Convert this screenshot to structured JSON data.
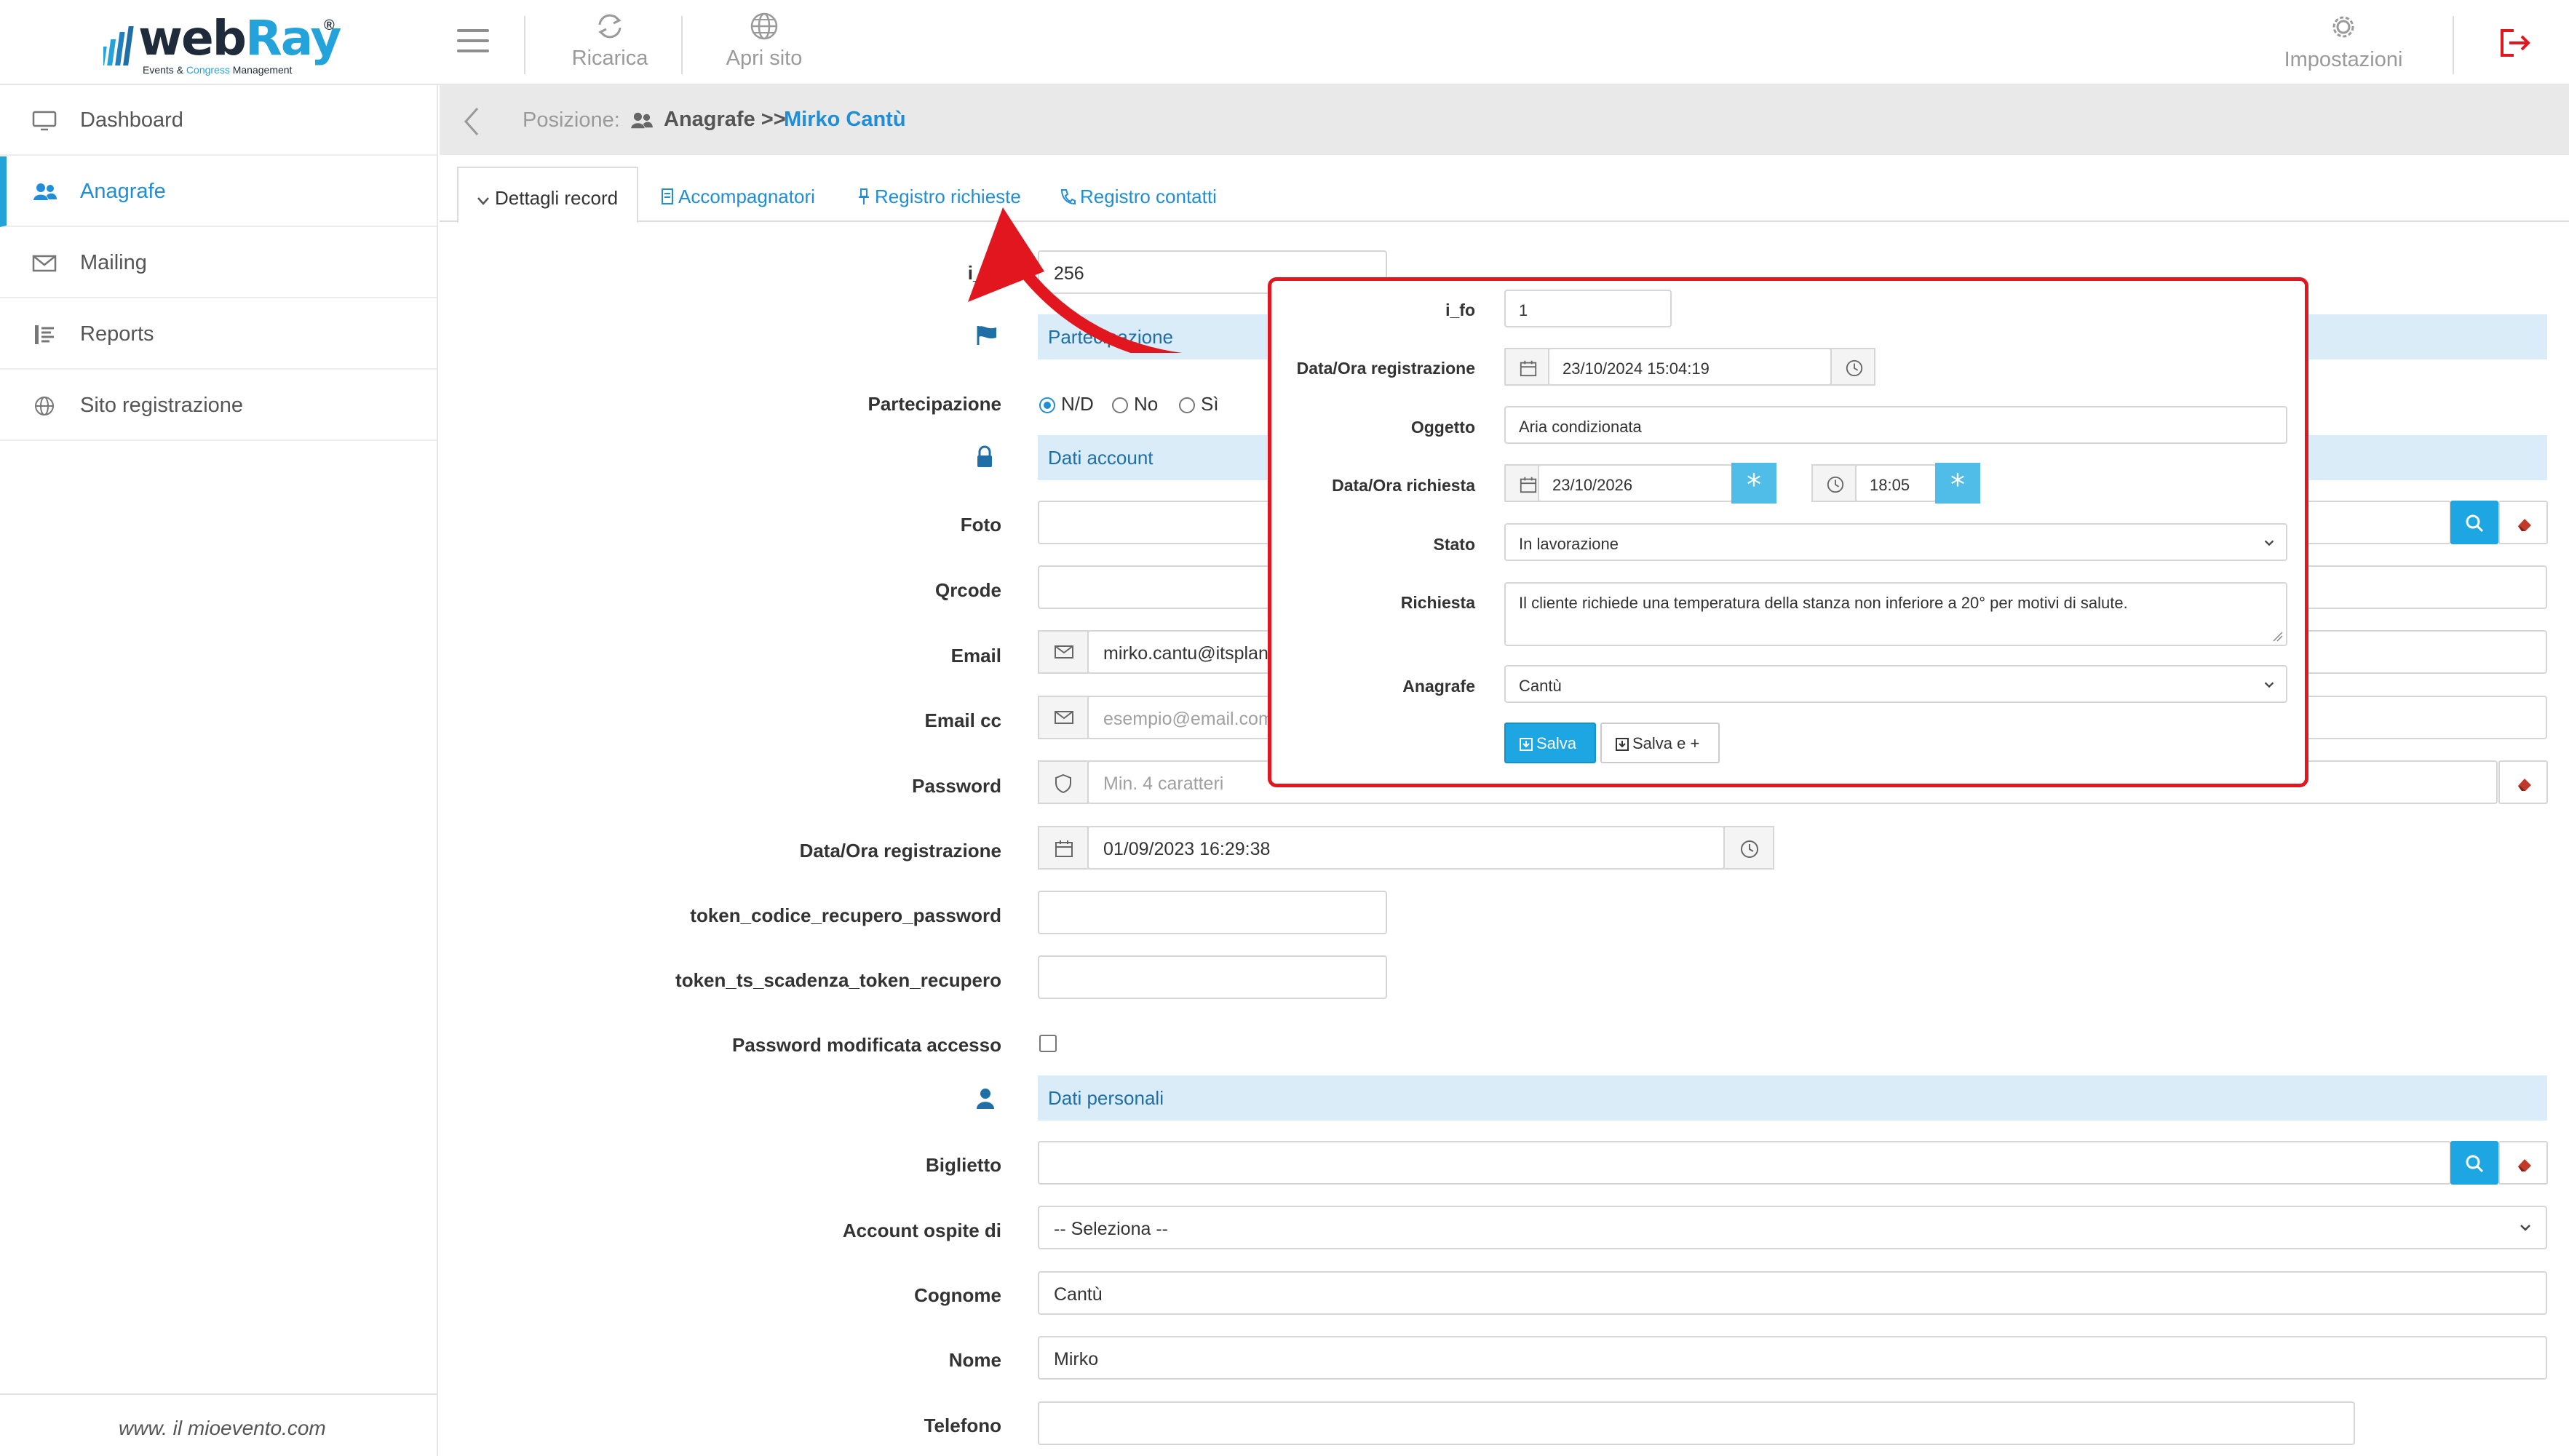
{
  "brand": {
    "name_a": "web",
    "name_b": "Ray",
    "reg": "®",
    "sub_a": "Events & ",
    "sub_b": "Congress",
    "sub_c": " Management"
  },
  "toolbar": {
    "reload_label": "Ricarica",
    "open_site_label": "Apri sito",
    "settings_label": "Impostazioni"
  },
  "sidebar": {
    "items": [
      {
        "label": "Dashboard"
      },
      {
        "label": "Anagrafe"
      },
      {
        "label": "Mailing"
      },
      {
        "label": "Reports"
      },
      {
        "label": "Sito registrazione"
      }
    ],
    "footer": "www. il mioevento.com",
    "active_index": 1
  },
  "breadcrumb": {
    "prefix": "Posizione:",
    "section": "Anagrafe",
    "sep": ">>",
    "current": "Mirko Cantù"
  },
  "tabs": [
    {
      "label": "Dettagli record",
      "active": true
    },
    {
      "label": "Accompagnatori"
    },
    {
      "label": "Registro richieste"
    },
    {
      "label": "Registro contatti"
    }
  ],
  "form": {
    "id_label": "i_fo",
    "id_value": "256",
    "section_participation": "Partecipazione",
    "participation_label": "Partecipazione",
    "participation_options": [
      "N/D",
      "No",
      "Sì"
    ],
    "participation_selected": "N/D",
    "section_account": "Dati account",
    "foto_label": "Foto",
    "qrcode_label": "Qrcode",
    "email_label": "Email",
    "email_value": "mirko.cantu@itsplanet.it",
    "emailcc_label": "Email cc",
    "emailcc_placeholder": "esempio@email.com",
    "password_label": "Password",
    "password_placeholder": "Min. 4 caratteri",
    "regdate_label": "Data/Ora registrazione",
    "regdate_value": "01/09/2023 16:29:38",
    "token_code_label": "token_codice_recupero_password",
    "token_ts_label": "token_ts_scadenza_token_recupero",
    "pwd_changed_label": "Password modificata accesso",
    "section_personal": "Dati personali",
    "ticket_label": "Biglietto",
    "guest_label": "Account ospite di",
    "guest_value": "-- Seleziona --",
    "surname_label": "Cognome",
    "surname_value": "Cantù",
    "name_label": "Nome",
    "name_value": "Mirko",
    "phone_label": "Telefono"
  },
  "popup": {
    "id_label": "i_fo",
    "id_value": "1",
    "regdate_label": "Data/Ora registrazione",
    "regdate_value": "23/10/2024 15:04:19",
    "subject_label": "Oggetto",
    "subject_value": "Aria condizionata",
    "reqdate_label": "Data/Ora richiesta",
    "reqdate_value": "23/10/2026",
    "reqtime_value": "18:05",
    "status_label": "Stato",
    "status_value": "In lavorazione",
    "request_label": "Richiesta",
    "request_value": "Il cliente richiede una temperatura della stanza non inferiore a 20° per motivi di salute.",
    "registry_label": "Anagrafe",
    "registry_value": "Cantù",
    "save_label": "Salva",
    "save_plus_label": "Salva e +"
  },
  "colors": {
    "accent": "#1ea6e3",
    "link": "#1f8ed6",
    "highlight_border": "#e2161f",
    "section_bg": "#d9ecf7"
  }
}
